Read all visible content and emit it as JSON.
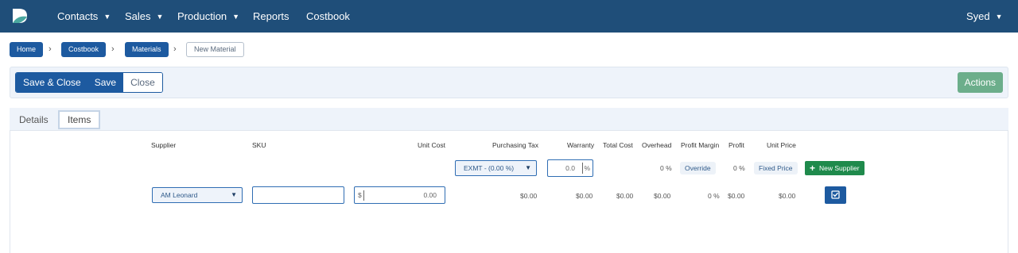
{
  "nav": {
    "items": [
      {
        "label": "Contacts",
        "has_caret": true
      },
      {
        "label": "Sales",
        "has_caret": true
      },
      {
        "label": "Production",
        "has_caret": true
      },
      {
        "label": "Reports",
        "has_caret": false
      },
      {
        "label": "Costbook",
        "has_caret": false
      }
    ],
    "user": "Syed",
    "caret": "▼"
  },
  "breadcrumb": {
    "items": [
      "Home",
      "Costbook",
      "Materials",
      "New Material"
    ],
    "separator": "›"
  },
  "toolbar": {
    "save_close": "Save & Close",
    "save": "Save",
    "close": "Close",
    "actions": "Actions"
  },
  "tabs": {
    "details": "Details",
    "items": "Items",
    "active": "Items"
  },
  "table": {
    "headers": {
      "supplier": "Supplier",
      "sku": "SKU",
      "unit_cost": "Unit Cost",
      "purchasing_tax": "Purchasing Tax",
      "warranty": "Warranty",
      "total_cost": "Total Cost",
      "overhead": "Overhead",
      "profit_margin": "Profit Margin",
      "profit": "Profit",
      "unit_price": "Unit Price"
    },
    "defaults": {
      "purchasing_tax": "EXMT - (0.00 %)",
      "warranty_value": "0.0",
      "warranty_unit": "%",
      "overhead": "0 %",
      "profit_margin_button": "Override",
      "profit": "0 %",
      "unit_price_button": "Fixed Price",
      "new_supplier": "New Supplier"
    },
    "row": {
      "supplier": "AM Leonard",
      "sku": "",
      "currency": "$",
      "unit_cost": "0.00",
      "purchasing_tax": "$0.00",
      "warranty": "$0.00",
      "total_cost": "$0.00",
      "overhead": "$0.00",
      "profit_margin": "0 %",
      "profit": "$0.00",
      "unit_price": "$0.00"
    }
  },
  "colors": {
    "nav_bg": "#1f4e79",
    "primary": "#1d5aa0",
    "success": "#1f8a4c",
    "actions": "#6cae8b"
  }
}
